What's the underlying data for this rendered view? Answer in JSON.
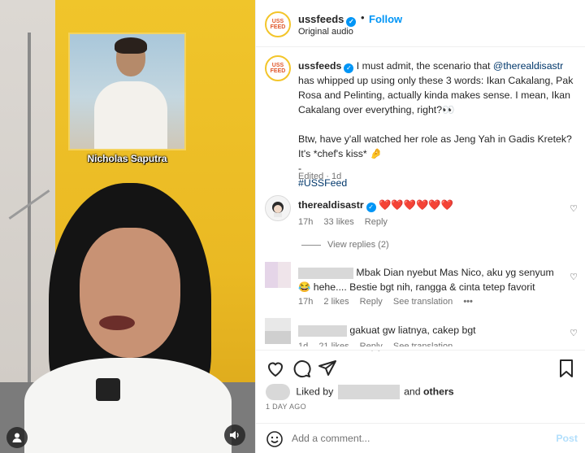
{
  "video": {
    "overlay_caption": "Nicholas Saputra"
  },
  "header": {
    "avatar_text": "USS FEED",
    "username": "ussfeeds",
    "dot": "•",
    "follow_label": "Follow",
    "audio_label": "Original audio"
  },
  "caption": {
    "username": "ussfeeds",
    "text_pre": "I must admit, the scenario that ",
    "mention": "@therealdisastr",
    "text_post": " has whipped up using only these 3 words: Ikan Cakalang, Pak Rosa and Pelinting, actually kinda makes sense. I mean, Ikan Cakalang over everything, right?👀",
    "line2": "Btw, have y'all watched her role as Jeng Yah in Gadis Kretek? It's *chef's kiss* 🤌",
    "dash": "-",
    "hashtag": "#USSFeed",
    "meta": "Edited · 1d"
  },
  "comments": [
    {
      "username": "therealdisastr",
      "text": "❤️❤️❤️❤️❤️❤️",
      "time": "17h",
      "likes": "33 likes",
      "reply": "Reply",
      "view_replies": "View replies (2)"
    },
    {
      "text": "Mbak Dian nyebut Mas Nico, aku yg senyum 😂 hehe.... Bestie bgt nih, rangga & cinta tetep favorit",
      "time": "17h",
      "likes": "2 likes",
      "reply": "Reply",
      "translation": "See translation",
      "more": "•••"
    },
    {
      "text": "gakuat gw liatnya, cakep bgt",
      "time": "1d",
      "likes": "21 likes",
      "reply": "Reply",
      "translation": "See translation"
    }
  ],
  "likes": {
    "prefix": "Liked by",
    "and": "and",
    "others": "others"
  },
  "posted_ago": "1 DAY AGO",
  "add_comment": {
    "placeholder": "Add a comment...",
    "post_label": "Post"
  },
  "colors": {
    "accent_blue": "#0095f6",
    "post_disabled": "#b2dffc"
  }
}
